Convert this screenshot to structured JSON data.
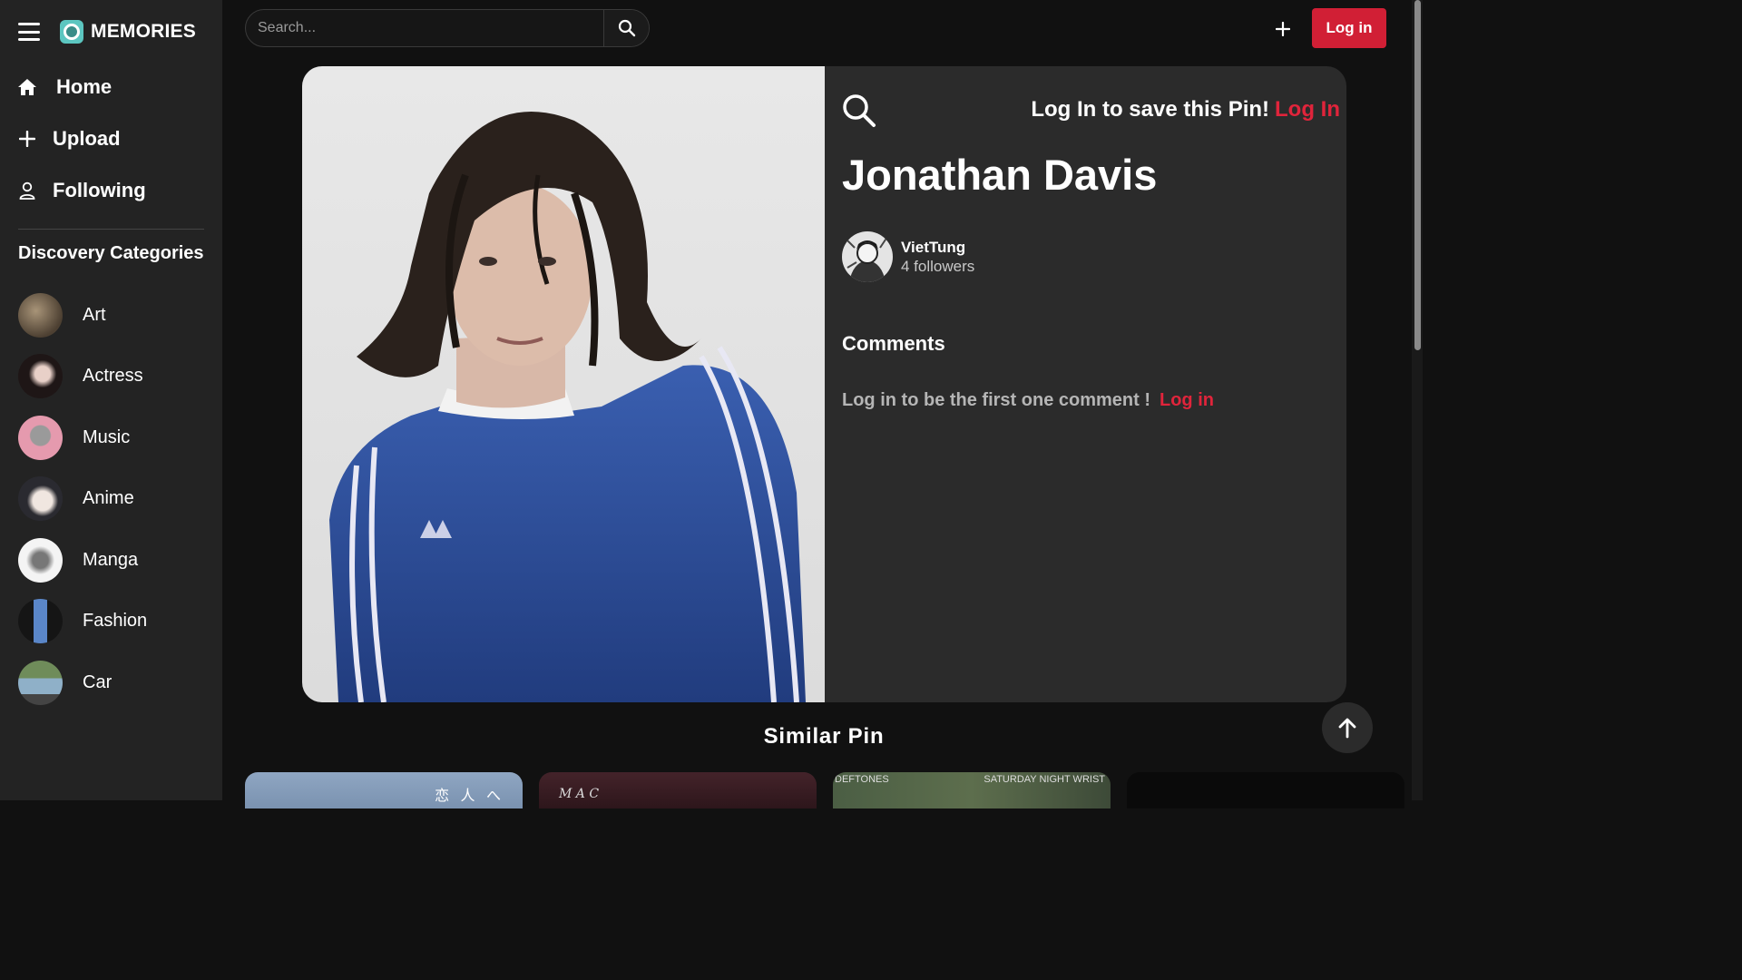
{
  "brand": {
    "name": "MEMORIES"
  },
  "nav": [
    {
      "label": "Home",
      "icon": "home-icon"
    },
    {
      "label": "Upload",
      "icon": "plus-icon"
    },
    {
      "label": "Following",
      "icon": "user-icon"
    }
  ],
  "categories_title": "Discovery Categories",
  "categories": [
    {
      "label": "Art",
      "color": "#6d5d48"
    },
    {
      "label": "Actress",
      "color": "#3a2a2a"
    },
    {
      "label": "Music",
      "color": "#d89aa8"
    },
    {
      "label": "Anime",
      "color": "#4a4a52"
    },
    {
      "label": "Manga",
      "color": "#e8e8e8"
    },
    {
      "label": "Fashion",
      "color": "#2f4f8a"
    },
    {
      "label": "Car",
      "color": "#6e8aa0"
    }
  ],
  "search": {
    "placeholder": "Search..."
  },
  "header": {
    "login_label": "Log in"
  },
  "pin": {
    "save_prompt": "Log In to save this Pin!",
    "save_link": "Log In",
    "title": "Jonathan Davis",
    "author_name": "VietTung",
    "author_followers": "4 followers",
    "comments_heading": "Comments",
    "comments_empty": "Log in to be the first one comment !",
    "comments_link": "Log in"
  },
  "similar": {
    "heading": "Similar Pin",
    "thumbs": [
      {
        "text": "恋 人 へ",
        "color": "#8fa6c2"
      },
      {
        "text": "M A C",
        "color": "#3a1e22"
      },
      {
        "text_left": "DEFTONES",
        "text_right": "SATURDAY NIGHT WRIST",
        "color": "#3d4f3a"
      },
      {
        "text": "",
        "color": "#0a0a0a"
      }
    ]
  },
  "colors": {
    "accent": "#d11f35",
    "sidebar": "#232323",
    "card": "#2b2b2b",
    "background": "#111111"
  }
}
